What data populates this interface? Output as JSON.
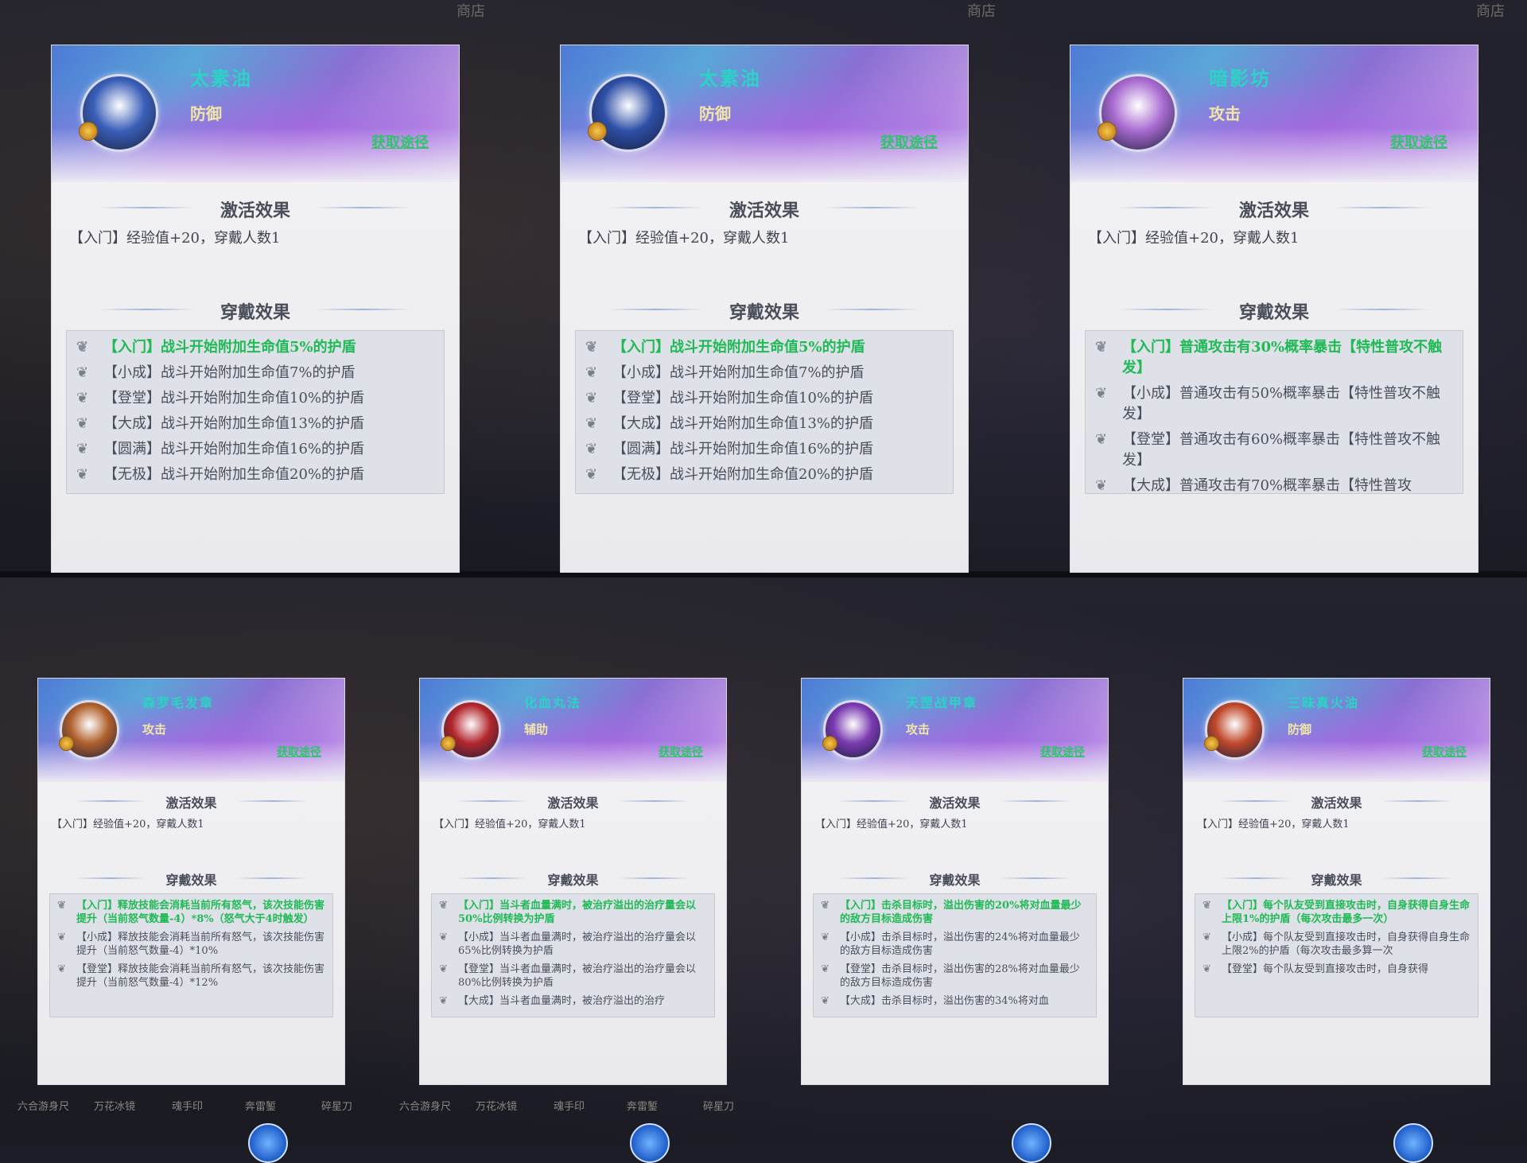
{
  "shop_label": "商店",
  "section_titles": {
    "activate": "激活效果",
    "wear": "穿戴效果"
  },
  "obtain_label": "获取途径",
  "cards_top": [
    {
      "name": "太素油",
      "type": "防御",
      "activate": "【入门】经验值+20，穿戴人数1",
      "portrait_color": "#3a5fb8",
      "effects": [
        "【入门】战斗开始附加生命值5%的护盾",
        "【小成】战斗开始附加生命值7%的护盾",
        "【登堂】战斗开始附加生命值10%的护盾",
        "【大成】战斗开始附加生命值13%的护盾",
        "【圆满】战斗开始附加生命值16%的护盾",
        "【无极】战斗开始附加生命值20%的护盾"
      ]
    },
    {
      "name": "太素油",
      "type": "防御",
      "activate": "【入门】经验值+20，穿戴人数1",
      "portrait_color": "#2d4fa6",
      "effects": [
        "【入门】战斗开始附加生命值5%的护盾",
        "【小成】战斗开始附加生命值7%的护盾",
        "【登堂】战斗开始附加生命值10%的护盾",
        "【大成】战斗开始附加生命值13%的护盾",
        "【圆满】战斗开始附加生命值16%的护盾",
        "【无极】战斗开始附加生命值20%的护盾"
      ]
    },
    {
      "name": "暗影坊",
      "type": "攻击",
      "activate": "【入门】经验值+20，穿戴人数1",
      "portrait_color": "#a86ad0",
      "effects": [
        "【入门】普通攻击有30%概率暴击【特性普攻不触发】",
        "【小成】普通攻击有50%概率暴击【特性普攻不触发】",
        "【登堂】普通攻击有60%概率暴击【特性普攻不触发】",
        "【大成】普通攻击有70%概率暴击【特性普攻"
      ]
    }
  ],
  "cards_bottom": [
    {
      "name": "森罗毛发章",
      "type": "攻击",
      "activate": "【入门】经验值+20，穿戴人数1",
      "portrait_color": "#b0602c",
      "effects": [
        "【入门】释放技能会消耗当前所有怒气，该次技能伤害提升（当前怒气数量-4）*8%（怒气大于4时触发）",
        "【小成】释放技能会消耗当前所有怒气，该次技能伤害提升（当前怒气数量-4）*10%",
        "【登堂】释放技能会消耗当前所有怒气，该次技能伤害提升（当前怒气数量-4）*12%"
      ]
    },
    {
      "name": "化血丸法",
      "type": "辅助",
      "activate": "【入门】经验值+20，穿戴人数1",
      "portrait_color": "#b2262c",
      "effects": [
        "【入门】当斗者血量满时，被治疗溢出的治疗量会以50%比例转换为护盾",
        "【小成】当斗者血量满时，被治疗溢出的治疗量会以65%比例转换为护盾",
        "【登堂】当斗者血量满时，被治疗溢出的治疗量会以80%比例转换为护盾",
        "【大成】当斗者血量满时，被治疗溢出的治疗"
      ]
    },
    {
      "name": "天罡战甲章",
      "type": "攻击",
      "activate": "【入门】经验值+20，穿戴人数1",
      "portrait_color": "#7a3ab0",
      "effects": [
        "【入门】击杀目标时，溢出伤害的20%将对血量最少的敌方目标造成伤害",
        "【小成】击杀目标时，溢出伤害的24%将对血量最少的敌方目标造成伤害",
        "【登堂】击杀目标时，溢出伤害的28%将对血量最少的敌方目标造成伤害",
        "【大成】击杀目标时，溢出伤害的34%将对血"
      ]
    },
    {
      "name": "三昧真火油",
      "type": "防御",
      "activate": "【入门】经验值+20，穿戴人数1",
      "portrait_color": "#c0482a",
      "effects": [
        "【入门】每个队友受到直接攻击时，自身获得自身生命上限1%的护盾（每次攻击最多一次）",
        "【小成】每个队友受到直接攻击时，自身获得自身生命上限2%的护盾（每次攻击最多算一次",
        "【登堂】每个队友受到直接攻击时，自身获得"
      ]
    }
  ],
  "bottom_labels": [
    "六合游身尺",
    "万花冰镜",
    "魂手印",
    "奔雷錾",
    "碎星刀"
  ]
}
